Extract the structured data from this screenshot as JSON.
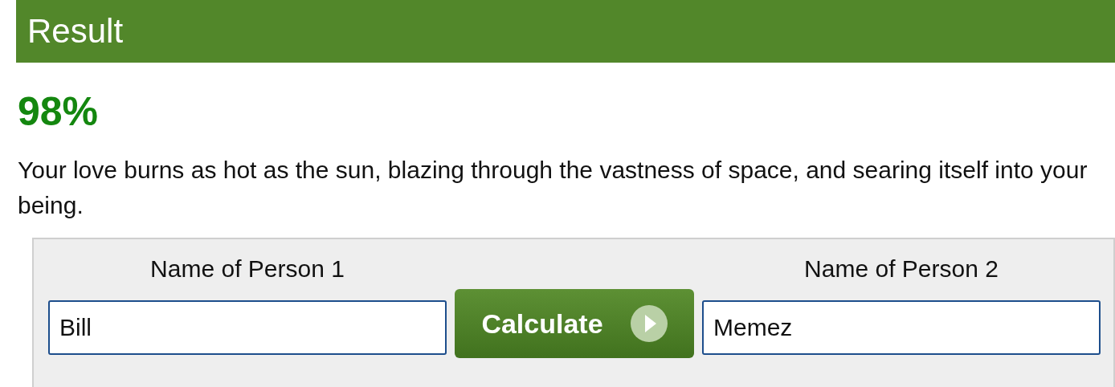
{
  "header": {
    "title": "Result"
  },
  "result": {
    "percent": "98%",
    "message": "Your love burns as hot as the sun, blazing through the vastness of space, and searing itself into your being."
  },
  "form": {
    "label_1": "Name of Person 1",
    "value_1": "Bill",
    "button": "Calculate",
    "label_2": "Name of Person 2",
    "value_2": "Memez"
  }
}
